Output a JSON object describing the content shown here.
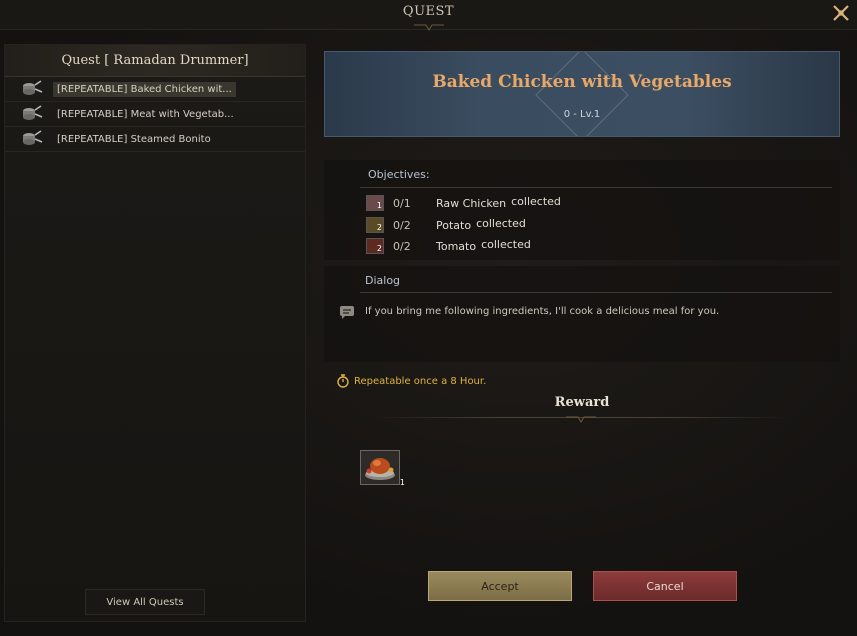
{
  "window": {
    "title": "QUEST"
  },
  "quest_list": {
    "header": "Quest [ Ramadan Drummer]",
    "items": [
      {
        "label": "[REPEATABLE] Baked Chicken wit..."
      },
      {
        "label": "[REPEATABLE] Meat with Vegetab..."
      },
      {
        "label": "[REPEATABLE] Steamed Bonito"
      }
    ],
    "view_all_label": "View All Quests"
  },
  "detail": {
    "title": "Baked Chicken with Vegetables",
    "level": "0 - Lv.1",
    "objectives_header": "Objectives:",
    "objectives": [
      {
        "count": "0/1",
        "item": "Raw Chicken",
        "verb": "collected",
        "qty": "1",
        "color": "#c98a8a"
      },
      {
        "count": "0/2",
        "item": "Potato",
        "verb": "collected",
        "qty": "2",
        "color": "#b08a3a"
      },
      {
        "count": "0/2",
        "item": "Tomato",
        "verb": "collected",
        "qty": "2",
        "color": "#c0442c"
      }
    ],
    "dialog_header": "Dialog",
    "dialog_text": "If you bring me following ingredients, I'll cook a delicious meal for you.",
    "repeatable_text": "Repeatable once a 8 Hour.",
    "reward_header": "Reward",
    "reward_qty": "1"
  },
  "buttons": {
    "accept": "Accept",
    "cancel": "Cancel"
  },
  "colors": {
    "accent_title": "#e9a868",
    "repeat_text": "#e0b23e",
    "accept_bg": "#9a8a5e",
    "cancel_bg": "#8d3b3b"
  }
}
